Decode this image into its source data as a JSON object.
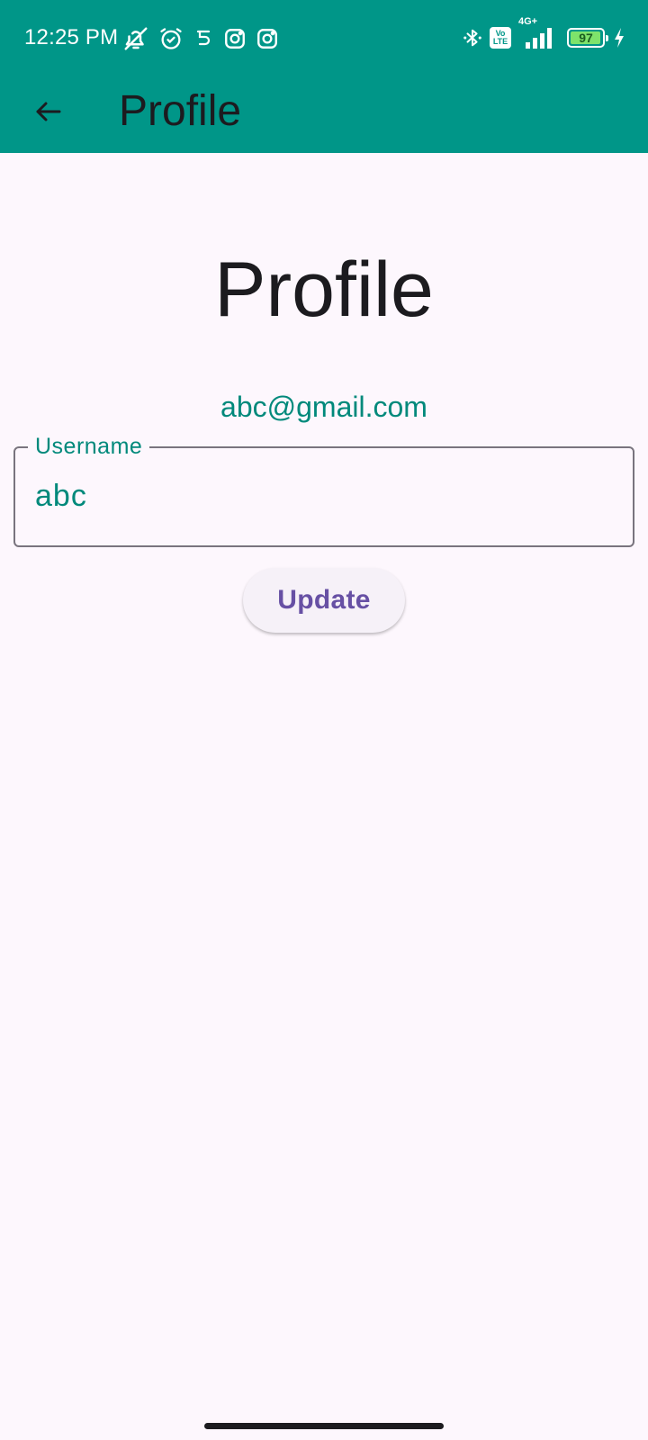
{
  "status_bar": {
    "time": "12:25 PM",
    "left_icons": [
      "notifications-off-icon",
      "alarm-icon",
      "app-notification-icon",
      "instagram-icon",
      "instagram-icon"
    ],
    "right_icons": [
      "bluetooth-icon",
      "volte-icon",
      "signal-icon",
      "battery-icon",
      "charging-icon"
    ],
    "network_type": "4G+",
    "volte_label_top": "Vo",
    "volte_label_bottom": "LTE",
    "battery_level": "97",
    "battery_fraction": 0.97
  },
  "app_bar": {
    "title": "Profile",
    "back_icon": "arrow-left-icon",
    "background_color": "#009688"
  },
  "main": {
    "heading": "Profile",
    "email": "abc@gmail.com",
    "username_field": {
      "label": "Username",
      "value": "abc"
    },
    "update_button_label": "Update"
  },
  "colors": {
    "primary": "#009688",
    "accent_text": "#00897b",
    "button_text": "#6750a4",
    "background": "#fdf7fd"
  }
}
